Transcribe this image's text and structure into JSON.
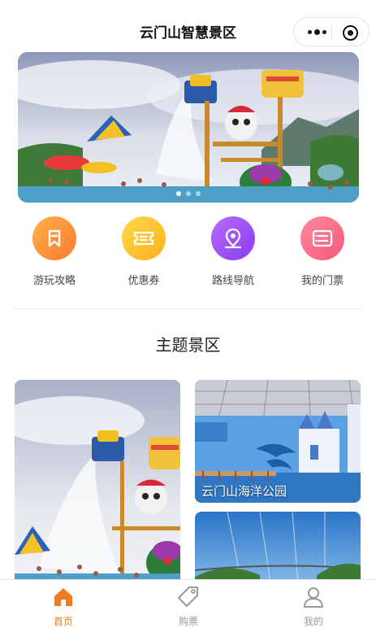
{
  "nav": {
    "title": "云门山智慧景区"
  },
  "banner": {
    "dot_count": 3,
    "active_dot": 0
  },
  "quick": [
    {
      "label": "游玩攻略",
      "icon": "bookmark-icon",
      "color_from": "#ffb04a",
      "color_to": "#ff7a32"
    },
    {
      "label": "优惠券",
      "icon": "coupon-icon",
      "color_from": "#ffd84a",
      "color_to": "#ffb01f"
    },
    {
      "label": "路线导航",
      "icon": "map-pin-icon",
      "color_from": "#b66cff",
      "color_to": "#8a3cf0"
    },
    {
      "label": "我的门票",
      "icon": "ticket-list-icon",
      "color_from": "#ff8a9c",
      "color_to": "#f25a7a"
    }
  ],
  "section": {
    "title": "主题景区"
  },
  "cards": [
    {
      "label": ""
    },
    {
      "label": "云门山海洋公园"
    },
    {
      "label": ""
    }
  ],
  "tabbar": {
    "items": [
      {
        "label": "首页",
        "icon": "home-icon",
        "active": true
      },
      {
        "label": "购票",
        "icon": "tag-icon",
        "active": false
      },
      {
        "label": "我的",
        "icon": "user-icon",
        "active": false
      }
    ],
    "active_color": "#f07a22",
    "inactive_color": "#999999"
  }
}
